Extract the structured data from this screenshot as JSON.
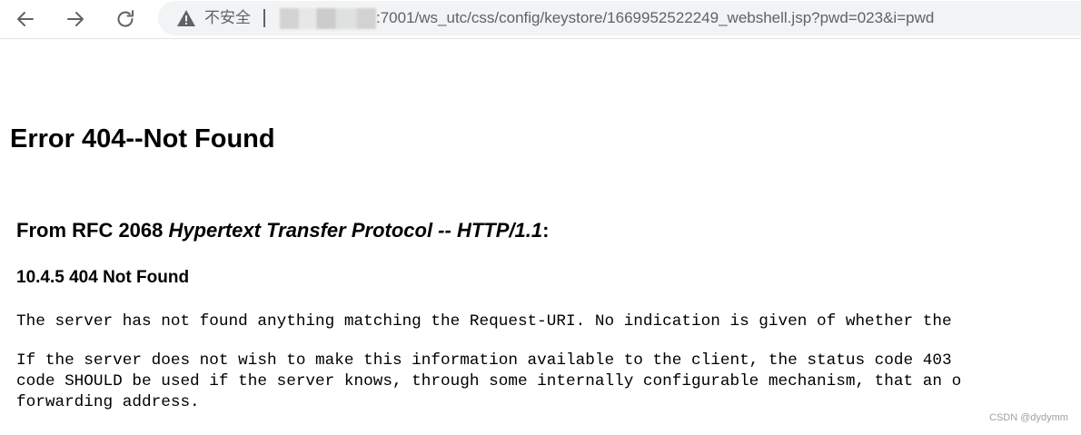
{
  "browser": {
    "nav": {
      "back_icon": "arrow-left-icon",
      "forward_icon": "arrow-right-icon",
      "reload_icon": "reload-icon"
    },
    "address_bar": {
      "security_icon": "warning-triangle-icon",
      "security_label": "不安全",
      "url_visible": ":7001/ws_utc/css/config/keystore/1669952522249_webshell.jsp?pwd=023&i=pwd"
    }
  },
  "page": {
    "title": "Error 404--Not Found",
    "rfc_heading": {
      "prefix": "From RFC 2068 ",
      "italic": "Hypertext Transfer Protocol -- HTTP/1.1",
      "suffix": ":"
    },
    "section_heading": "10.4.5 404 Not Found",
    "paragraph1": "The server has not found anything matching the Request-URI. No indication is given of whether the",
    "paragraph2_lines": [
      "If the server does not wish to make this information available to the client, the status code 403",
      "code SHOULD be used if the server knows, through some internally configurable mechanism, that an o",
      "forwarding address."
    ]
  },
  "watermark": "CSDN @dydymm",
  "colors": {
    "toolbar_icon": "#5f6368",
    "omnibox_bg": "#f1f3f4",
    "text": "#000000",
    "watermark": "#a0a0a0"
  }
}
